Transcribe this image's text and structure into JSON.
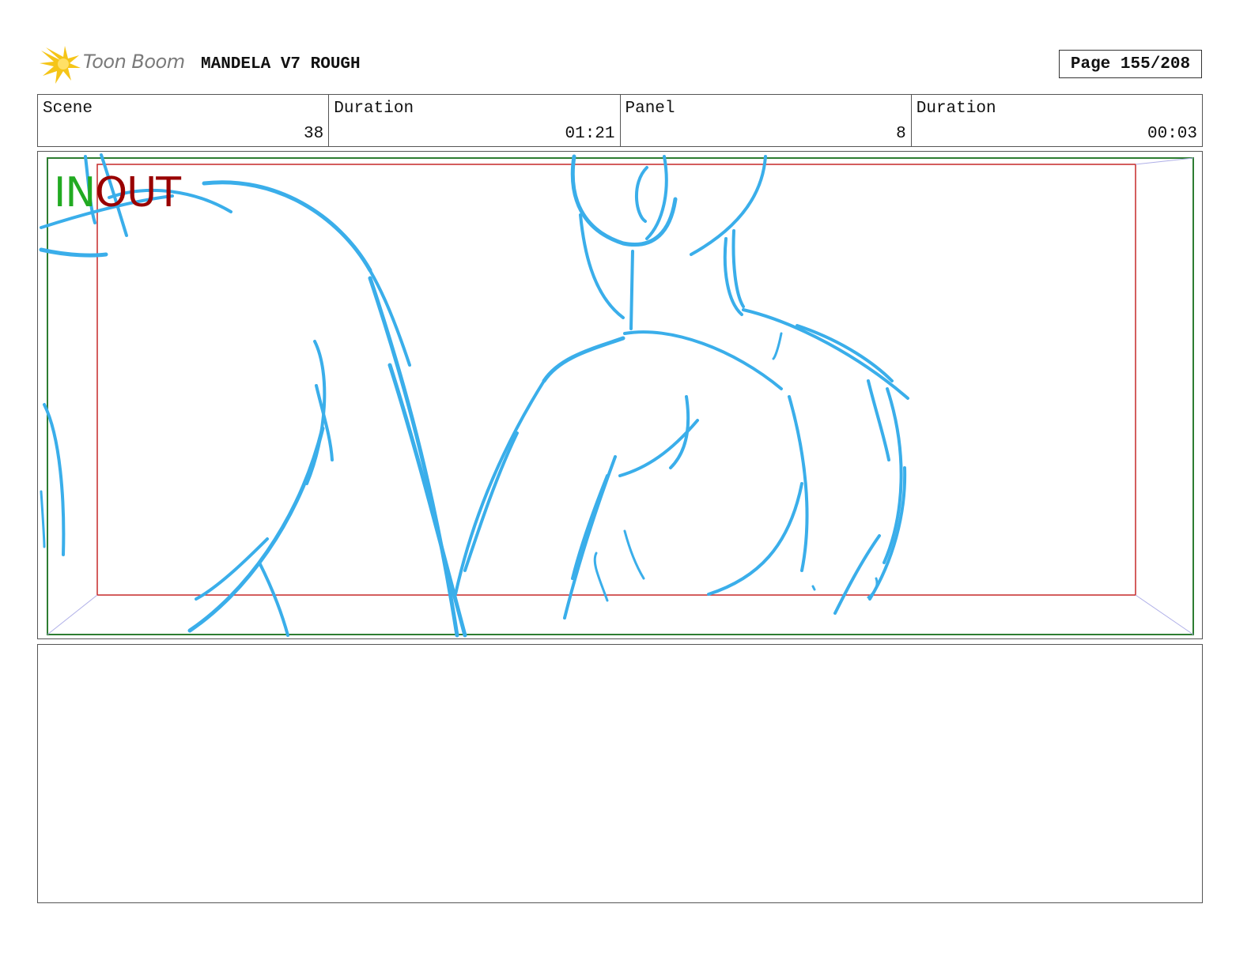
{
  "header": {
    "brand": "Toon Boom",
    "project_title": "MANDELA V7 ROUGH",
    "page_label": "Page 155/208"
  },
  "info": [
    {
      "label": "Scene",
      "value": "38"
    },
    {
      "label": "Duration",
      "value": "01:21"
    },
    {
      "label": "Panel",
      "value": "8"
    },
    {
      "label": "Duration",
      "value": "00:03"
    }
  ],
  "panel": {
    "in_label": "IN",
    "out_label": "OUT",
    "sketch_color": "#3aaeea",
    "camera_in_color": "#2e7d32",
    "camera_out_color": "#c62828"
  },
  "notes": {
    "text": ""
  }
}
